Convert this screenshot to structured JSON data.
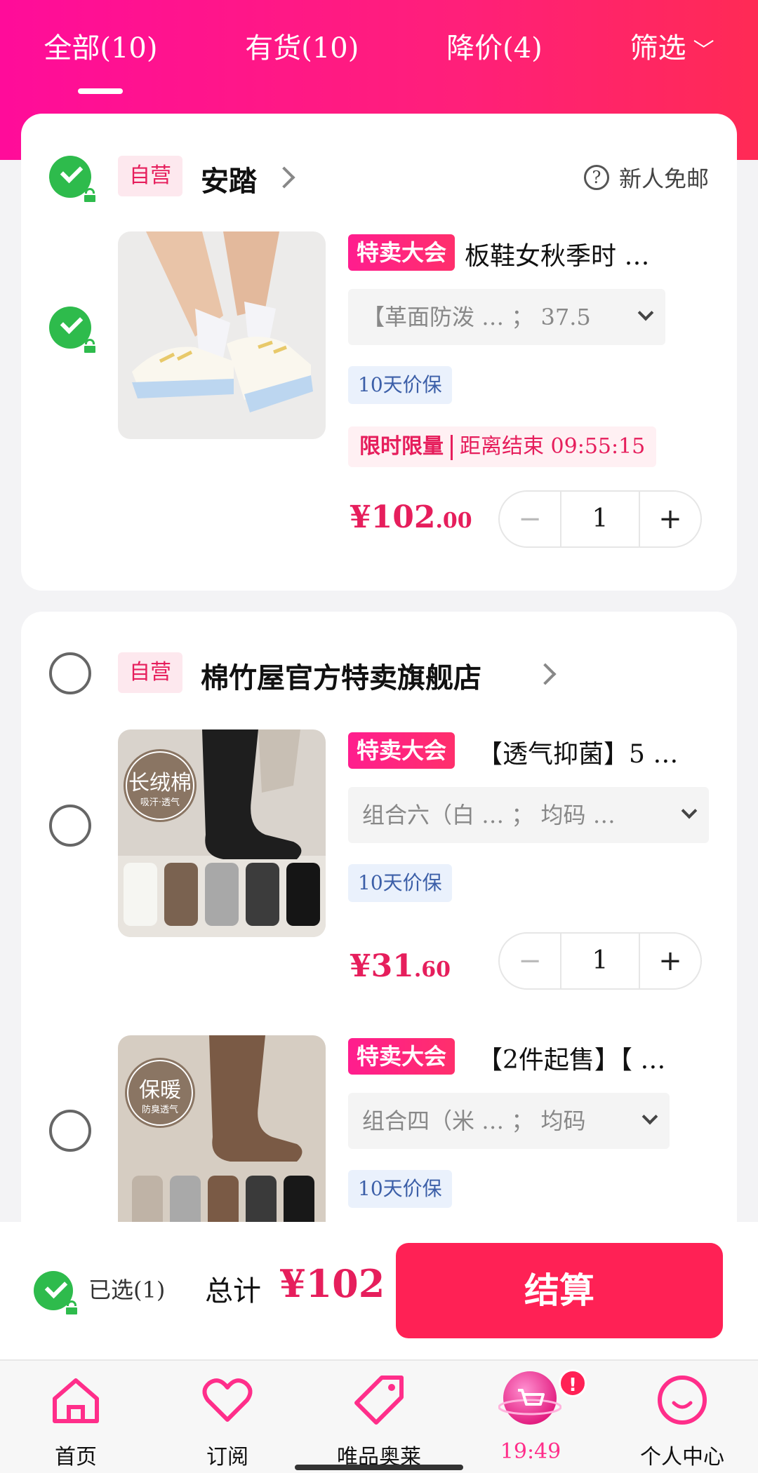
{
  "tabs": [
    {
      "label": "全部(10)"
    },
    {
      "label": "有货(10)"
    },
    {
      "label": "降价(4)"
    },
    {
      "label": "筛选",
      "icon": "chevron-down-icon"
    }
  ],
  "stores": [
    {
      "tag": "自营",
      "name": "安踏",
      "shipping": "新人免邮",
      "items": [
        {
          "promo": "特卖大会",
          "title": "板鞋女秋季时 …",
          "sku": "【革面防泼 … ； 37.5",
          "guarantee": "10天价保",
          "flash_label": "限时限量",
          "flash_end": "距离结束 09:55:15",
          "price_int": "¥102",
          "price_dec": ".00",
          "qty": "1"
        }
      ]
    },
    {
      "tag": "自营",
      "name": "棉竹屋官方特卖旗舰店",
      "items": [
        {
          "promo": "特卖大会",
          "title": "【透气抑菌】5 …",
          "sku": "组合六（白 … ； 均码 …",
          "guarantee": "10天价保",
          "price_int": "¥31",
          "price_dec": ".60",
          "qty": "1",
          "img_text_main": "长绒棉",
          "img_text_sub": "吸汗·透气"
        },
        {
          "promo": "特卖大会",
          "title": "【2件起售】【 …",
          "sku": "组合四（米 … ； 均码",
          "guarantee": "10天价保",
          "img_text_main": "保暖",
          "img_text_sub": "防臭透气"
        }
      ]
    }
  ],
  "checkout": {
    "selected": "已选(1)",
    "total_label": "总计",
    "total_value": "¥102",
    "button": "结算"
  },
  "nav": [
    {
      "label": "首页",
      "icon": "home-icon"
    },
    {
      "label": "订阅",
      "icon": "heart-icon"
    },
    {
      "label": "唯品奥莱",
      "icon": "tag-icon"
    },
    {
      "label": "19:49",
      "icon": "cart-icon",
      "badge": "!"
    },
    {
      "label": "个人中心",
      "icon": "smile-icon"
    }
  ],
  "colors": {
    "brand_pink": "#ff1f7a",
    "price_red": "#e61e5c",
    "check_green": "#2ebb4c",
    "checkout_btn": "#ff2155"
  }
}
